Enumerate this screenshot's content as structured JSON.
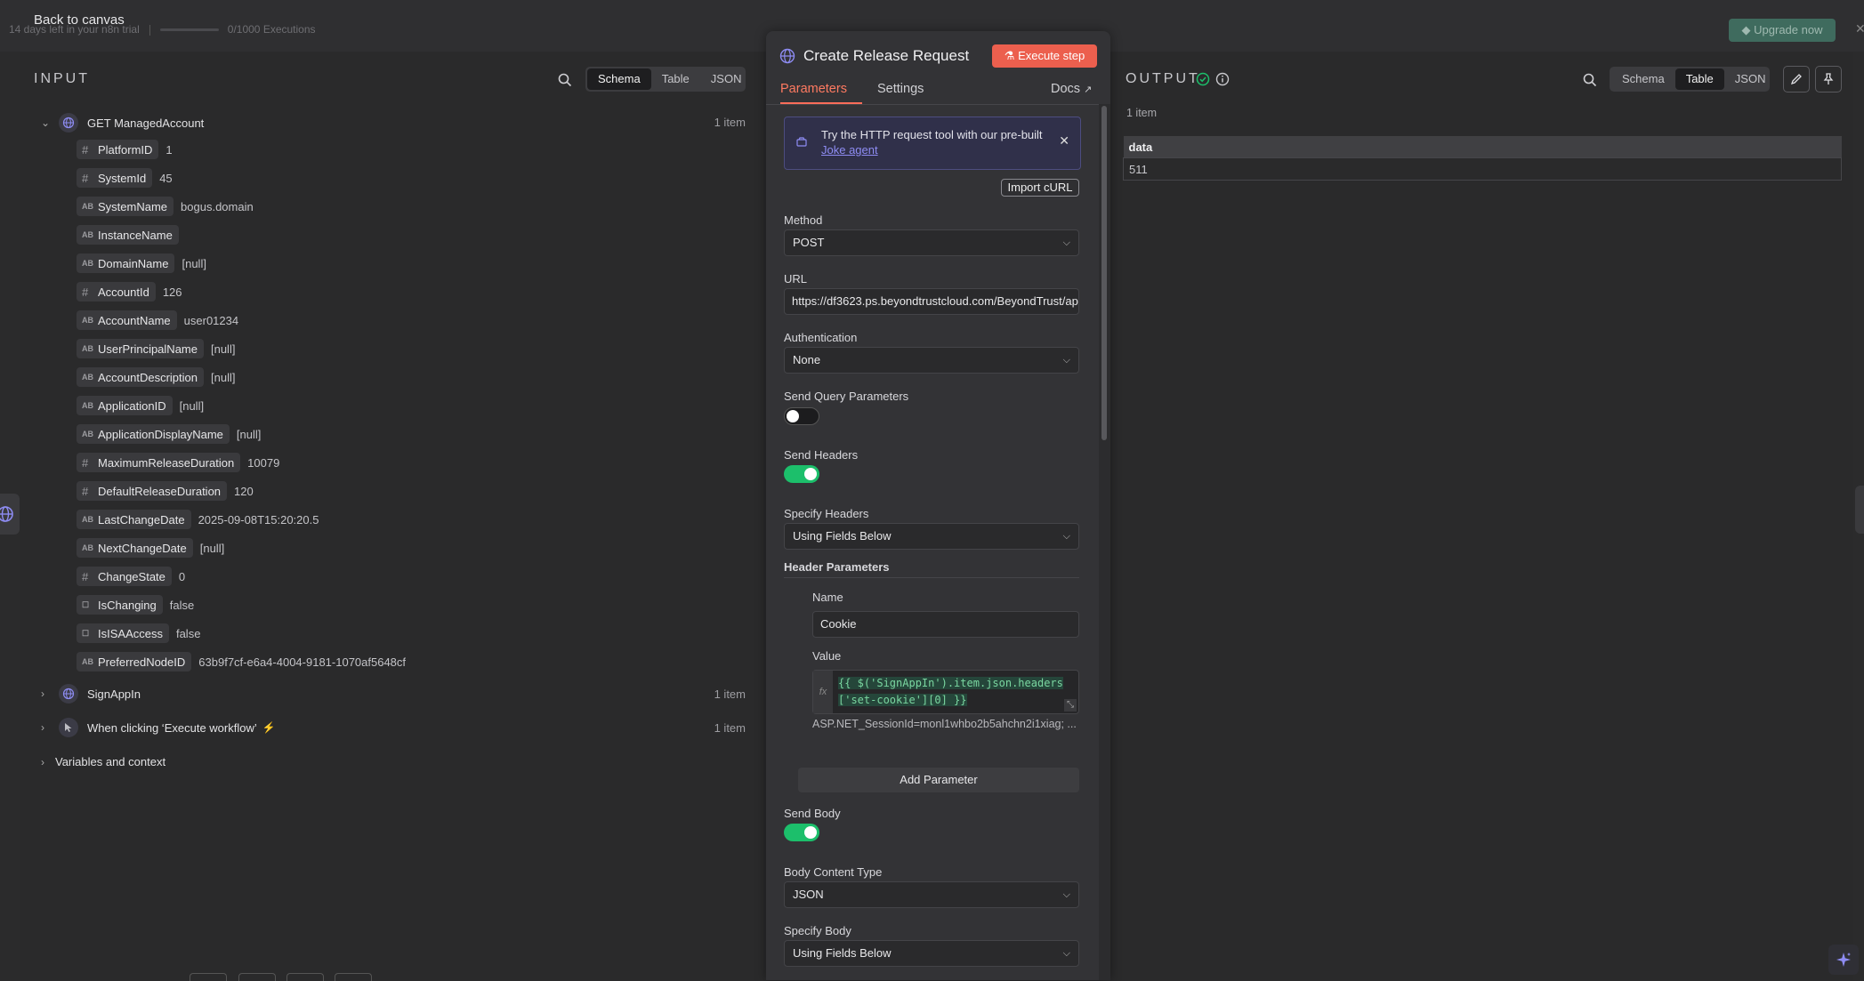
{
  "topbar": {
    "back_label": "Back to canvas",
    "trial_text": "14 days left in your n8n trial",
    "executions_text": "0/1000 Executions",
    "upgrade_label": "Upgrade now"
  },
  "input_panel": {
    "title": "INPUT",
    "views": [
      "Schema",
      "Table",
      "JSON"
    ],
    "active_view": "Schema",
    "nodes": [
      {
        "name": "GET ManagedAccount",
        "count": "1 item",
        "expanded": true
      },
      {
        "name": "SignAppIn",
        "count": "1 item",
        "expanded": false
      },
      {
        "name": "When clicking ‘Execute workflow’",
        "count": "1 item",
        "expanded": false
      }
    ],
    "fields": [
      {
        "type": "number",
        "key": "PlatformID",
        "value": "1"
      },
      {
        "type": "number",
        "key": "SystemId",
        "value": "45"
      },
      {
        "type": "string",
        "key": "SystemName",
        "value": "bogus.domain"
      },
      {
        "type": "string",
        "key": "InstanceName",
        "value": ""
      },
      {
        "type": "string",
        "key": "DomainName",
        "value": "[null]"
      },
      {
        "type": "number",
        "key": "AccountId",
        "value": "126"
      },
      {
        "type": "string",
        "key": "AccountName",
        "value": "user01234"
      },
      {
        "type": "string",
        "key": "UserPrincipalName",
        "value": "[null]"
      },
      {
        "type": "string",
        "key": "AccountDescription",
        "value": "[null]"
      },
      {
        "type": "string",
        "key": "ApplicationID",
        "value": "[null]"
      },
      {
        "type": "string",
        "key": "ApplicationDisplayName",
        "value": "[null]"
      },
      {
        "type": "number",
        "key": "MaximumReleaseDuration",
        "value": "10079"
      },
      {
        "type": "number",
        "key": "DefaultReleaseDuration",
        "value": "120"
      },
      {
        "type": "string",
        "key": "LastChangeDate",
        "value": "2025-09-08T15:20:20.5"
      },
      {
        "type": "string",
        "key": "NextChangeDate",
        "value": "[null]"
      },
      {
        "type": "number",
        "key": "ChangeState",
        "value": "0"
      },
      {
        "type": "boolean",
        "key": "IsChanging",
        "value": "false"
      },
      {
        "type": "boolean",
        "key": "IsISAAccess",
        "value": "false"
      },
      {
        "type": "string",
        "key": "PreferredNodeID",
        "value": "63b9f7cf-e6a4-4004-9181-1070af5648cf"
      }
    ],
    "variables_label": "Variables and context"
  },
  "node_panel": {
    "title": "Create Release Request",
    "execute_label": "Execute step",
    "tabs": [
      "Parameters",
      "Settings"
    ],
    "docs_label": "Docs",
    "banner": {
      "text": "Try the HTTP request tool with our pre-built",
      "link": "Joke agent"
    },
    "import_curl_label": "Import cURL",
    "method": {
      "label": "Method",
      "value": "POST"
    },
    "url": {
      "label": "URL",
      "value": "https://df3623.ps.beyondtrustcloud.com/BeyondTrust/ap"
    },
    "authentication": {
      "label": "Authentication",
      "value": "None"
    },
    "send_query": {
      "label": "Send Query Parameters",
      "enabled": false
    },
    "send_headers": {
      "label": "Send Headers",
      "enabled": true
    },
    "specify_headers": {
      "label": "Specify Headers",
      "value": "Using Fields Below"
    },
    "header_parameters_label": "Header Parameters",
    "header_name": {
      "label": "Name",
      "value": "Cookie"
    },
    "header_value": {
      "label": "Value",
      "expr_line1": "{{ $('SignAppIn').item.json.headers",
      "expr_line2": "['set-cookie'][0] }}",
      "preview": "ASP.NET_SessionId=monl1whbo2b5ahchn2i1xiag; ..."
    },
    "add_parameter_label": "Add Parameter",
    "send_body": {
      "label": "Send Body",
      "enabled": true
    },
    "body_content_type": {
      "label": "Body Content Type",
      "value": "JSON"
    },
    "specify_body": {
      "label": "Specify Body",
      "value": "Using Fields Below"
    }
  },
  "output_panel": {
    "title": "OUTPUT",
    "views": [
      "Schema",
      "Table",
      "JSON"
    ],
    "active_view": "Table",
    "count": "1 item",
    "table": {
      "columns": [
        "data"
      ],
      "rows": [
        [
          "511"
        ]
      ]
    }
  },
  "colors": {
    "accent": "#ff6d5a",
    "toggle_on": "#1cbf6b",
    "success": "#1cbf6b"
  },
  "icons": [
    "search-icon",
    "globe-icon",
    "pointer-icon",
    "bolt-icon",
    "check-circle-icon",
    "info-icon",
    "pencil-icon",
    "pin-icon",
    "external-link-icon",
    "flask-icon",
    "sparkle-icon"
  ]
}
